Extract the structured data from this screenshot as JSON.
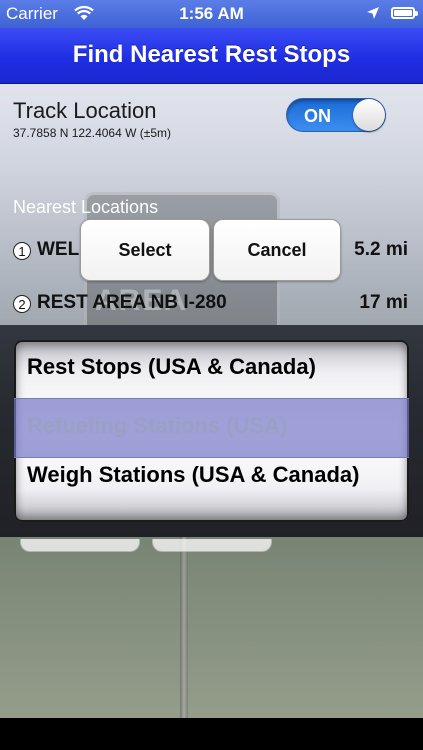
{
  "status_bar": {
    "carrier": "Carrier",
    "time": "1:56 AM"
  },
  "nav": {
    "title": "Find Nearest Rest Stops"
  },
  "track": {
    "label": "Track Location",
    "coordinates": "37.7858 N  122.4064 W (±5m)",
    "toggle_state": "ON",
    "toggle_color": "#2f80ea"
  },
  "nearest": {
    "label": "Nearest Locations",
    "items": [
      {
        "num": "1",
        "name": "WEL",
        "distance": "5.2 mi"
      },
      {
        "num": "2",
        "name": "REST AREA NB I-280",
        "distance": "17 mi"
      }
    ]
  },
  "action_buttons": {
    "select_label": "Select",
    "cancel_label": "Cancel"
  },
  "picker": {
    "options": [
      "Rest Stops (USA & Canada)",
      "Refueling Stations (USA)",
      "Weigh Stations (USA & Canada)"
    ],
    "selected_index": 1
  },
  "background_sign": "AREA"
}
